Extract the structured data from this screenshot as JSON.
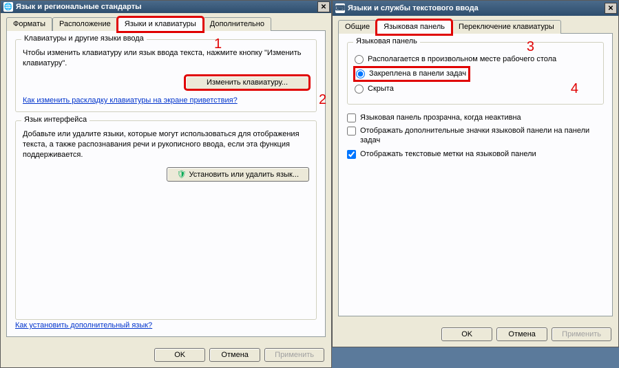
{
  "left": {
    "title": "Язык и региональные стандарты",
    "tabs": [
      "Форматы",
      "Расположение",
      "Языки и клавиатуры",
      "Дополнительно"
    ],
    "group1": {
      "legend": "Клавиатуры и другие языки ввода",
      "text": "Чтобы изменить клавиатуру или язык ввода текста, нажмите кнопку \"Изменить клавиатуру\".",
      "button": "Изменить клавиатуру...",
      "link": "Как изменить раскладку клавиатуры на экране приветствия?"
    },
    "group2": {
      "legend": "Язык интерфейса",
      "text": "Добавьте или удалите языки, которые могут использоваться для отображения текста, а также распознавания речи и рукописного ввода, если эта функция поддерживается.",
      "button": "Установить или удалить язык..."
    },
    "bottomlink": "Как установить дополнительный язык?",
    "buttons": {
      "ok": "OK",
      "cancel": "Отмена",
      "apply": "Применить"
    }
  },
  "right": {
    "title": "Языки и службы текстового ввода",
    "tabs": [
      "Общие",
      "Языковая панель",
      "Переключение клавиатуры"
    ],
    "group": {
      "legend": "Языковая панель",
      "radios": [
        "Располагается в произвольном месте рабочего стола",
        "Закреплена в панели задач",
        "Скрыта"
      ]
    },
    "checks": [
      "Языковая панель прозрачна, когда неактивна",
      "Отображать дополнительные значки языковой панели на панели задач",
      "Отображать текстовые метки на языковой панели"
    ],
    "buttons": {
      "ok": "OK",
      "cancel": "Отмена",
      "apply": "Применить"
    }
  },
  "markers": {
    "m1": "1",
    "m2": "2",
    "m3": "3",
    "m4": "4"
  }
}
